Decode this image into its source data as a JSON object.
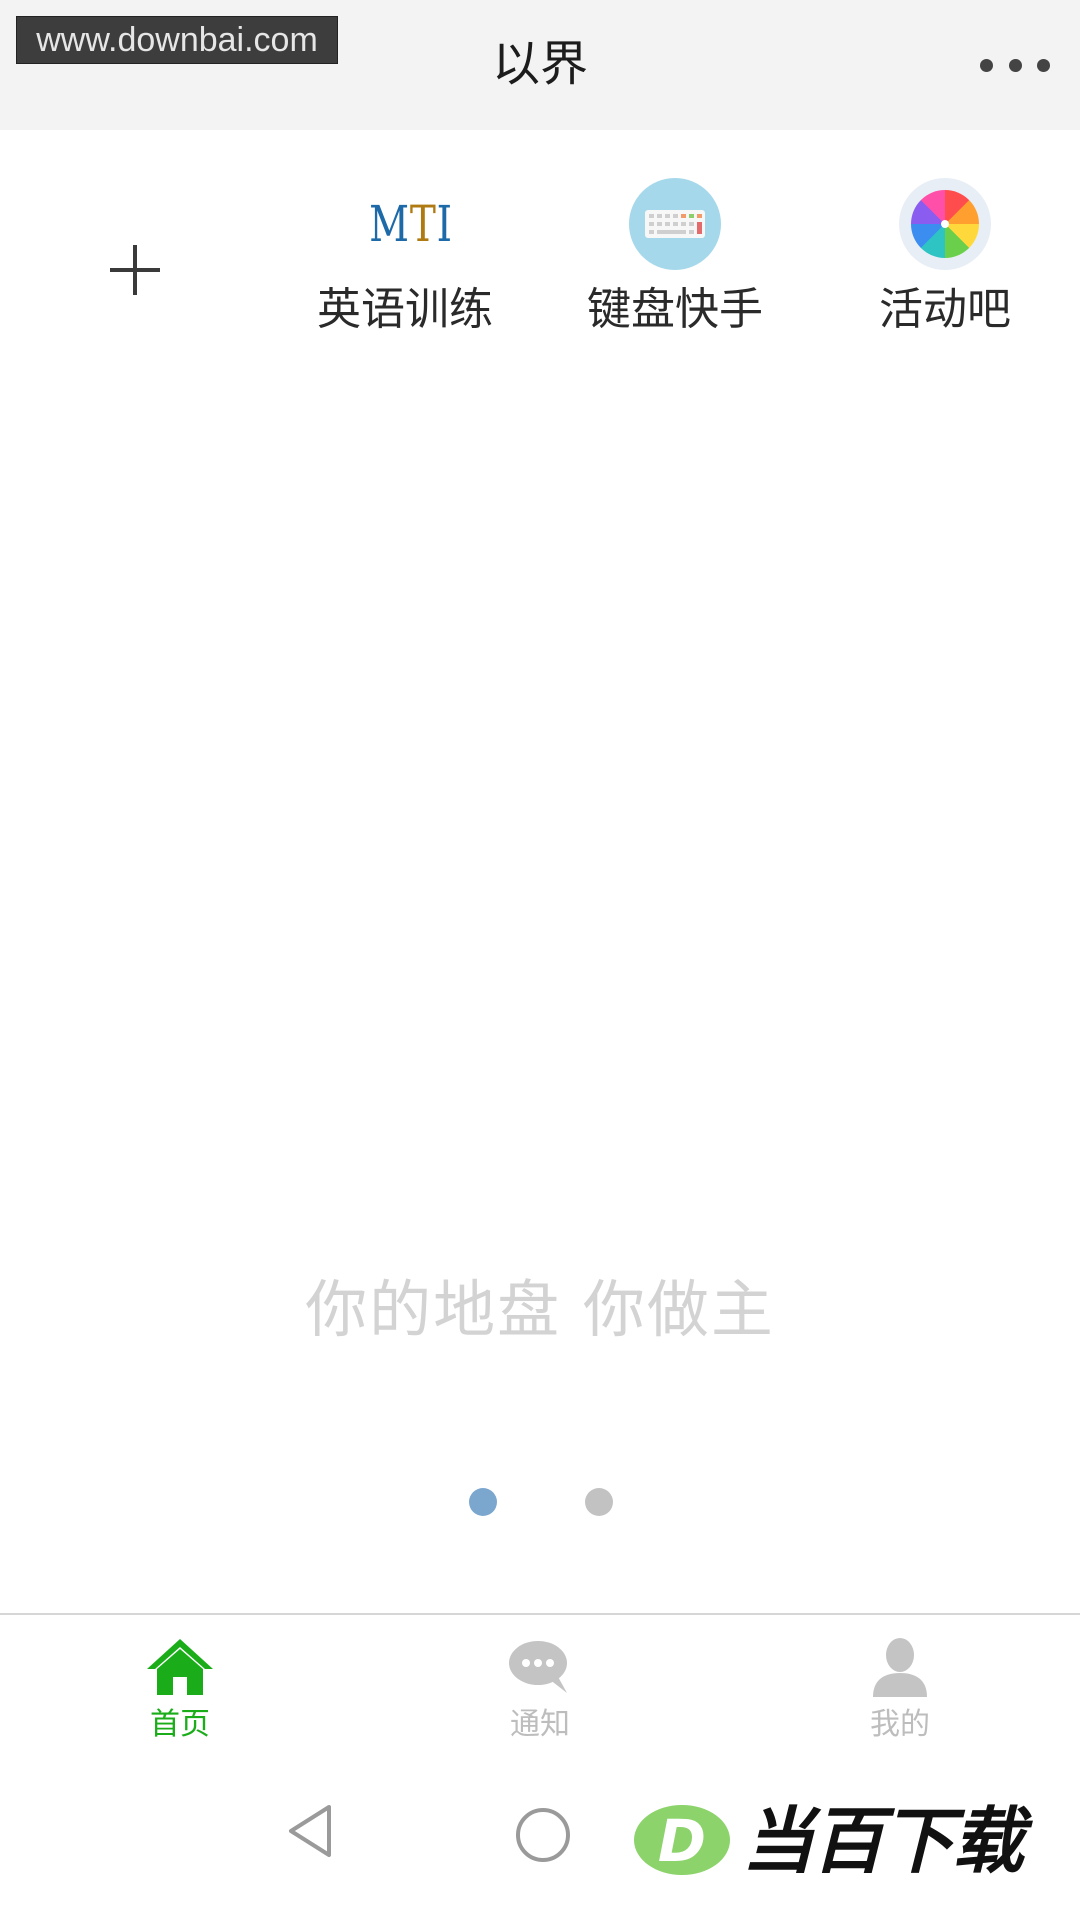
{
  "watermark": {
    "url": "www.downbai.com"
  },
  "header": {
    "title": "以界"
  },
  "apps": [
    {
      "label": "英语训练",
      "icon": "mti-logo-icon",
      "logo_text": [
        "M",
        "T",
        "I"
      ]
    },
    {
      "label": "键盘快手",
      "icon": "keyboard-icon"
    },
    {
      "label": "活动吧",
      "icon": "color-wheel-icon"
    }
  ],
  "banner": {
    "slogan": "你的地盘 你做主",
    "pages": 2,
    "current_page": 1
  },
  "tabbar": {
    "active_color": "#1aad19",
    "inactive_color": "#bdbdbd",
    "tabs": [
      {
        "label": "首页",
        "icon": "home-icon",
        "active": true
      },
      {
        "label": "通知",
        "icon": "chat-bubble-icon",
        "active": false
      },
      {
        "label": "我的",
        "icon": "person-icon",
        "active": false
      }
    ]
  },
  "brand_watermark": {
    "text": "当百下载",
    "logo_letter": "D",
    "logo_color": "#8bd36a"
  }
}
